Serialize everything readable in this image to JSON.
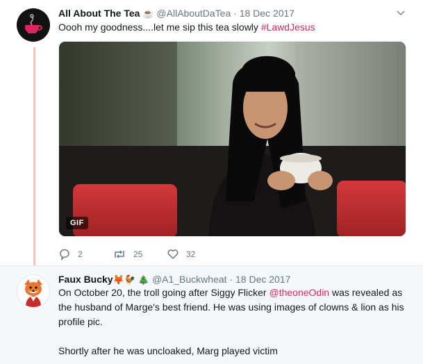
{
  "tweets": [
    {
      "display_name": "All About The Tea",
      "name_emoji": "☕",
      "handle": "@AllAboutDaTea",
      "separator": "·",
      "timestamp": "18 Dec 2017",
      "text": "Oooh my goodness....let me sip this tea slowly ",
      "hashtag": "#LawdJesus",
      "media_badge": "GIF",
      "actions": {
        "reply_icon": "reply-icon",
        "reply_count": "2",
        "retweet_icon": "retweet-icon",
        "retweet_count": "25",
        "like_icon": "heart-icon",
        "like_count": "32"
      }
    },
    {
      "display_name": "Faux Bucky",
      "name_emojis": [
        "🦊",
        "🐓",
        "🎄"
      ],
      "handle": "@A1_Buckwheat",
      "separator": "·",
      "timestamp": "18 Dec 2017",
      "text_line1_before_mention": "On October 20, the troll going after Siggy Flicker ",
      "mention": "@theoneOdin",
      "text_line1_after_mention": " was revealed as the husband of Marge's best friend. He was using images of clowns & lion as his profile pic.",
      "text_paragraph2": "Shortly after he was uncloaked, Marg played victim"
    }
  ],
  "colors": {
    "accent": "#e0245e",
    "thread_line": "#f5c6b8",
    "muted_text": "#657786",
    "reply_background": "#f5f8fa"
  }
}
